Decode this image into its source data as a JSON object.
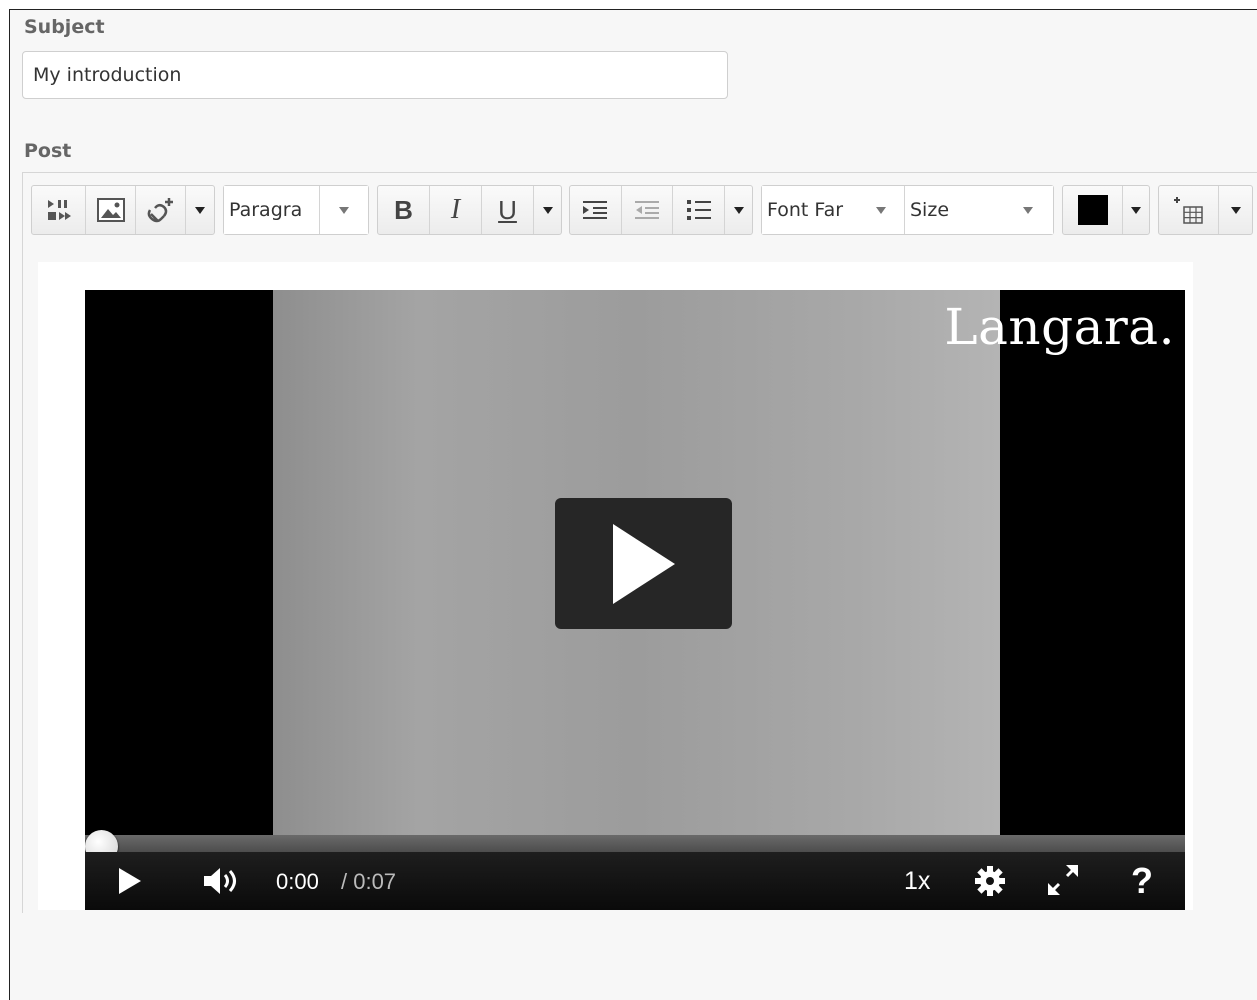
{
  "subject": {
    "label": "Subject",
    "value": "My introduction"
  },
  "post": {
    "label": "Post"
  },
  "toolbar": {
    "block_format": "Paragra",
    "bold": "B",
    "italic": "I",
    "underline": "U",
    "font_family": "Font Far",
    "font_size": "Size",
    "text_color": "#000000"
  },
  "video": {
    "watermark": "Langara.",
    "current_time": "0:00",
    "duration": "/ 0:07",
    "speed": "1x",
    "help": "?",
    "progress": 0
  }
}
